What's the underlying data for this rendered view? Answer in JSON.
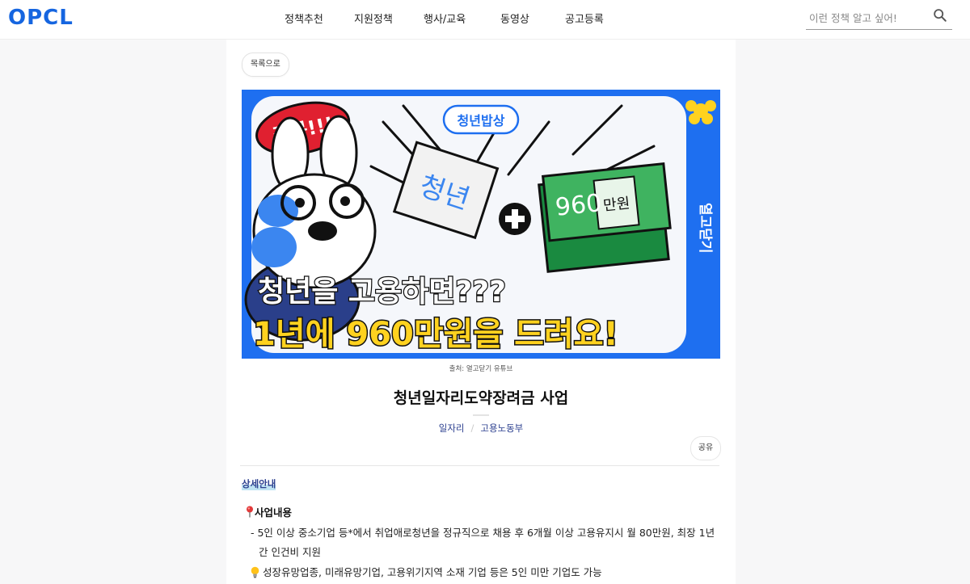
{
  "header": {
    "logo": "OPCL",
    "nav": [
      "정책추천",
      "지원정책",
      "행사/교육",
      "동영상",
      "공고등록"
    ],
    "search_placeholder": "이런 정책 알고 싶어!"
  },
  "page": {
    "back_label": "목록으로",
    "banner": {
      "badge": "주목!!!",
      "brand_top": "청년밥상",
      "sign_text": "청년",
      "money_text": "960",
      "money_unit": "만원",
      "side_brand": "열고닫기",
      "headline_1": "청년을 고용하면???",
      "headline_2": "1년에 960만원을 드려요!"
    },
    "image_credit": "출처: 열고닫기 유튜브",
    "title": "청년일자리도약장려금 사업",
    "tags": [
      "일자리",
      "고용노동부"
    ],
    "share_label": "공유",
    "section_title": "상세안내",
    "business_heading": "사업내용",
    "body_line_1": "- 5인 이상 중소기업 등*에서 취업애로청년을 정규직으로 채용 후 6개월 이상 고용유지시 월 80만원, 최장 1년",
    "body_line_2": "간 인건비 지원",
    "body_line_3": "성장유망업종, 미래유망기업, 고용위기지역 소재 기업 등은 5인 미만 기업도 가능"
  },
  "colors": {
    "brand_blue": "#1565e0",
    "banner_blue": "#1e6ff0",
    "tag_navy": "#2b3f8f",
    "headline_yellow": "#ffd21f",
    "money_green": "#1f9e4a"
  },
  "icons": [
    "search-icon",
    "pin-icon",
    "lightbulb-icon",
    "bunny-illustration",
    "plus-icon",
    "money-stack-icon",
    "flower-icon"
  ]
}
